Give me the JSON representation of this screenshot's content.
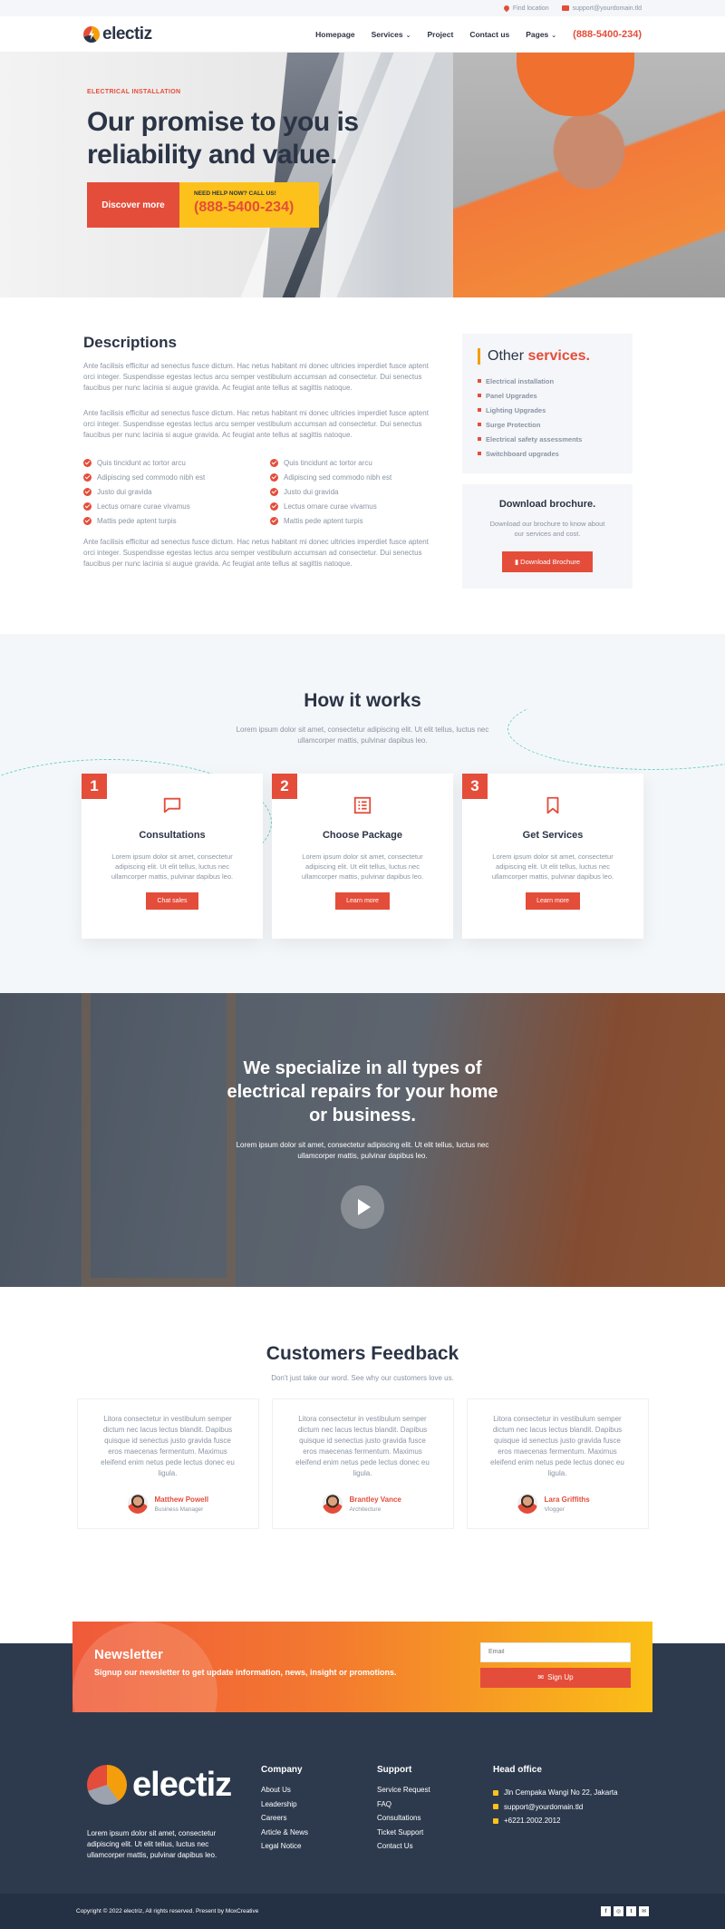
{
  "topbar": {
    "location": "Find location",
    "email": "support@yourdomain.tld"
  },
  "header": {
    "logo": "electiz",
    "nav": [
      {
        "label": "Homepage"
      },
      {
        "label": "Services",
        "dropdown": true
      },
      {
        "label": "Project"
      },
      {
        "label": "Contact us"
      },
      {
        "label": "Pages",
        "dropdown": true
      }
    ],
    "phone": "(888-5400-234)"
  },
  "hero": {
    "kicker": "ELECTRICAL INSTALLATION",
    "title": "Our promise to you is reliability and value.",
    "discover_label": "Discover more",
    "call_label": "NEED HELP NOW? CALL US!",
    "call_phone": "(888-5400-234)"
  },
  "descriptions": {
    "title": "Descriptions",
    "para1": "Ante facilisis efficitur ad senectus fusce dictum. Hac netus habitant mi donec ultricies imperdiet fusce aptent orci integer. Suspendisse egestas lectus arcu semper vestibulum accumsan ad consectetur. Dui senectus faucibus per nunc lacinia si augue gravida. Ac feugiat ante tellus at sagittis natoque.",
    "para2": "Ante facilisis efficitur ad senectus fusce dictum. Hac netus habitant mi donec ultricies imperdiet fusce aptent orci integer. Suspendisse egestas lectus arcu semper vestibulum accumsan ad consectetur. Dui senectus faucibus per nunc lacinia si augue gravida. Ac feugiat ante tellus at sagittis natoque.",
    "checks_left": [
      "Quis tincidunt ac tortor arcu",
      "Adipiscing sed commodo nibh est",
      "Justo dui gravida",
      "Lectus ornare curae vivamus",
      "Mattis pede aptent turpis"
    ],
    "checks_right": [
      "Quis tincidunt ac tortor arcu",
      "Adipiscing sed commodo nibh est",
      "Justo dui gravida",
      "Lectus ornare curae vivamus",
      "Mattis pede aptent turpis"
    ],
    "para3": "Ante facilisis efficitur ad senectus fusce dictum. Hac netus habitant mi donec ultricies imperdiet fusce aptent orci integer. Suspendisse egestas lectus arcu semper vestibulum accumsan ad consectetur. Dui senectus faucibus per nunc lacinia si augue gravida. Ac feugiat ante tellus at sagittis natoque."
  },
  "other_services": {
    "title_plain": "Other",
    "title_accent": "services.",
    "items": [
      "Electrical installation",
      "Panel Upgrades",
      "Lighting Upgrades",
      "Surge Protection",
      "Electrical safety assessments",
      "Switchboard upgrades"
    ]
  },
  "brochure": {
    "title": "Download brochure.",
    "text": "Download our brochure to know about our services and cost.",
    "button": "Download Brochure"
  },
  "how": {
    "title": "How it works",
    "subtitle": "Lorem ipsum dolor sit amet, consectetur adipiscing elit. Ut elit tellus, luctus nec ullamcorper mattis, pulvinar dapibus leo.",
    "steps": [
      {
        "num": "1",
        "icon": "chat-icon",
        "title": "Consultations",
        "text": "Lorem ipsum dolor sit amet, consectetur adipiscing elit. Ut elit tellus, luctus nec ullamcorper mattis, pulvinar dapibus leo.",
        "button": "Chat sales"
      },
      {
        "num": "2",
        "icon": "list-icon",
        "title": "Choose Package",
        "text": "Lorem ipsum dolor sit amet, consectetur adipiscing elit. Ut elit tellus, luctus nec ullamcorper mattis, pulvinar dapibus leo.",
        "button": "Learn more"
      },
      {
        "num": "3",
        "icon": "bookmark-icon",
        "title": "Get Services",
        "text": "Lorem ipsum dolor sit amet, consectetur adipiscing elit. Ut elit tellus, luctus nec ullamcorper mattis, pulvinar dapibus leo.",
        "button": "Learn more"
      }
    ]
  },
  "video": {
    "title": "We specialize in all types of electrical repairs for your home or business.",
    "text": "Lorem ipsum dolor sit amet, consectetur adipiscing elit. Ut elit tellus, luctus nec ullamcorper mattis, pulvinar dapibus leo."
  },
  "feedback": {
    "title": "Customers Feedback",
    "subtitle": "Don't just take our word. See why our customers love us.",
    "items": [
      {
        "text": "Litora consectetur in vestibulum semper dictum nec lacus lectus blandit. Dapibus quisque id senectus justo gravida fusce eros maecenas fermentum. Maximus eleifend enim netus pede lectus donec eu ligula.",
        "name": "Matthew Powell",
        "role": "Business Manager"
      },
      {
        "text": "Litora consectetur in vestibulum semper dictum nec lacus lectus blandit. Dapibus quisque id senectus justo gravida fusce eros maecenas fermentum. Maximus eleifend enim netus pede lectus donec eu ligula.",
        "name": "Brantley Vance",
        "role": "Architecture"
      },
      {
        "text": "Litora consectetur in vestibulum semper dictum nec lacus lectus blandit. Dapibus quisque id senectus justo gravida fusce eros maecenas fermentum. Maximus eleifend enim netus pede lectus donec eu ligula.",
        "name": "Lara Griffiths",
        "role": "Vlogger"
      }
    ]
  },
  "newsletter": {
    "title": "Newsletter",
    "text": "Signup our newsletter to get update information, news, insight or promotions.",
    "placeholder": "Email",
    "button": "Sign Up"
  },
  "footer": {
    "logo": "electiz",
    "about": "Lorem ipsum dolor sit amet, consectetur adipiscing elit. Ut elit tellus, luctus nec ullamcorper mattis, pulvinar dapibus leo.",
    "company_title": "Company",
    "company": [
      "About Us",
      "Leadership",
      "Careers",
      "Article & News",
      "Legal Notice"
    ],
    "support_title": "Support",
    "support": [
      "Service Request",
      "FAQ",
      "Consultations",
      "Ticket Support",
      "Contact Us"
    ],
    "office_title": "Head office",
    "office": [
      "Jln Cempaka Wangi No 22, Jakarta",
      "support@yourdomain.tld",
      "+6221.2002.2012"
    ],
    "copyright": "Copyright © 2022 electriz, All rights reserved. Present by MoxCreative",
    "socials": [
      "f",
      "◎",
      "t",
      "✉"
    ]
  },
  "colors": {
    "accent": "#e44d3a",
    "yellow": "#fcc21b",
    "dark": "#2b3445",
    "footer": "#2d3a4e"
  }
}
